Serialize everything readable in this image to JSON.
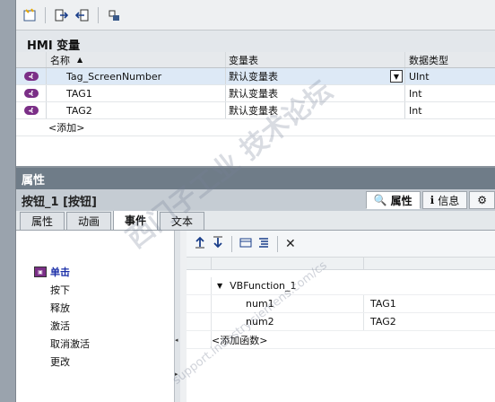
{
  "hmi": {
    "title": "HMI 变量",
    "columns": {
      "name": "名称",
      "table": "变量表",
      "type": "数据类型"
    },
    "rows": [
      {
        "name": "Tag_ScreenNumber",
        "table": "默认变量表",
        "type": "UInt"
      },
      {
        "name": "TAG1",
        "table": "默认变量表",
        "type": "Int"
      },
      {
        "name": "TAG2",
        "table": "默认变量表",
        "type": "Int"
      }
    ],
    "add_label": "<添加>"
  },
  "props": {
    "header": "属性",
    "object_title": "按钮_1 [按钮]",
    "inspector_tabs": {
      "properties": "属性",
      "info": "信息"
    },
    "tabs": [
      "属性",
      "动画",
      "事件",
      "文本"
    ],
    "events": [
      "单击",
      "按下",
      "释放",
      "激活",
      "取消激活",
      "更改"
    ],
    "function": {
      "name": "VBFunction_1",
      "params": [
        {
          "name": "num1",
          "value": "TAG1"
        },
        {
          "name": "num2",
          "value": "TAG2"
        }
      ],
      "add_label": "<添加函数>"
    }
  },
  "watermark": {
    "main": "西门子工业 技术论坛",
    "url": "support.industry.siemens.com/cs"
  },
  "colors": {
    "tag_icon": "#7b2f87",
    "selected_event": "#1a2ea8",
    "header_bg": "#6f7c88"
  }
}
